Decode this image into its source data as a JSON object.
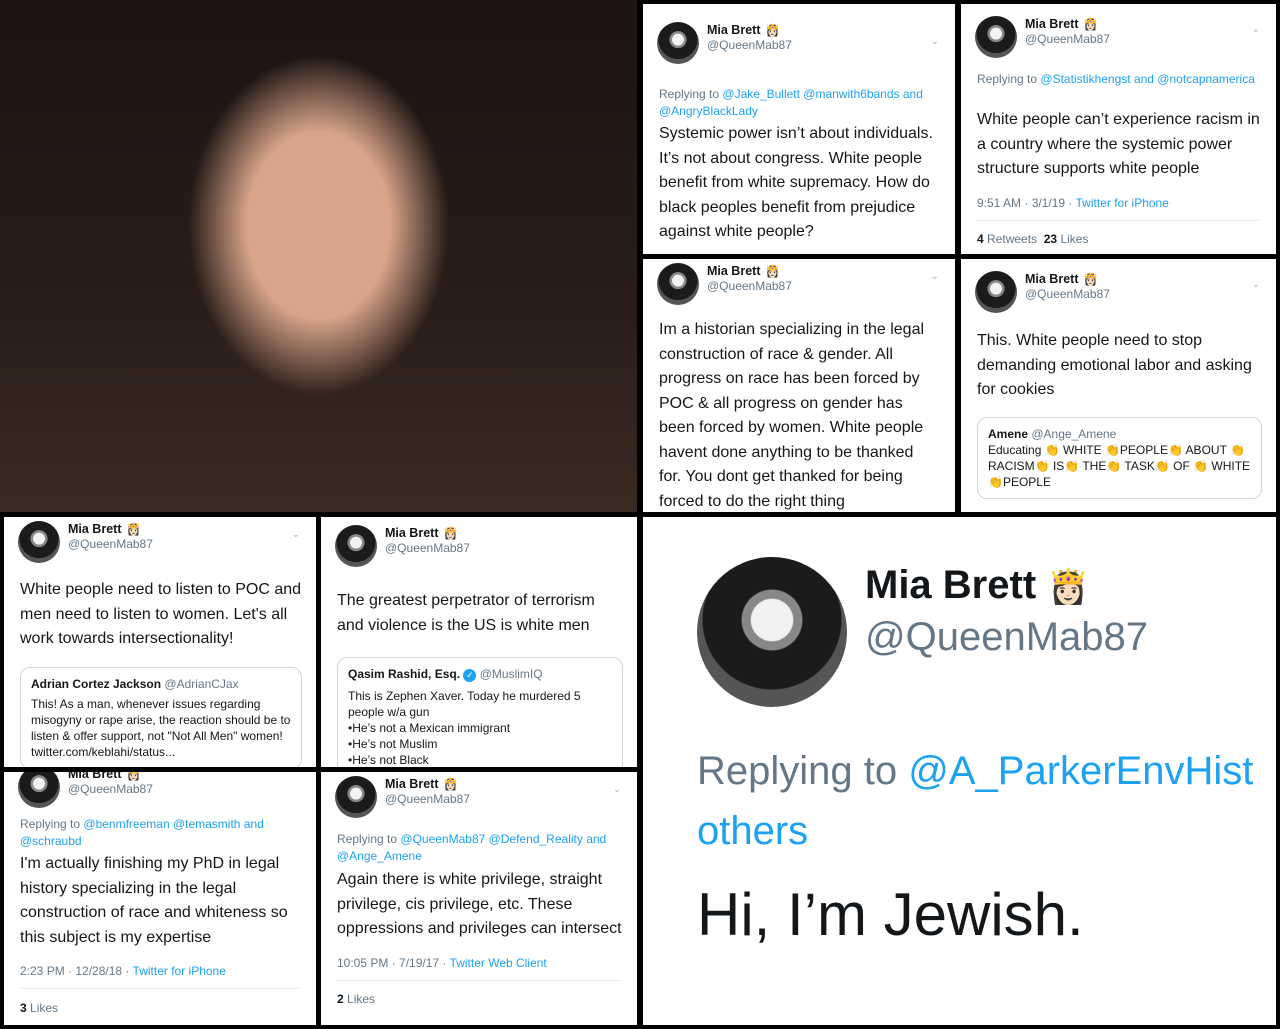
{
  "profile": {
    "name": "Mia Brett",
    "crown": "👸🏻",
    "handle": "@QueenMab87"
  },
  "tweets": [
    {
      "replying_prefix": "Replying to",
      "replying_to": "@Jake_Bullett @manwith6bands and @AngryBlackLady",
      "text": "Systemic power isn’t about individuals. It’s not about congress. White people benefit from white supremacy. How do black peoples benefit from prejudice against white people?"
    },
    {
      "replying_prefix": "Replying to",
      "replying_to": "@Statistikhengst and @notcapnamerica",
      "text": "White people can’t experience racism in a country where the systemic power structure supports white people",
      "time": "9:51 AM · 3/1/19 ·",
      "source": "Twitter for iPhone",
      "retweets_count": "4",
      "retweets_label": "Retweets",
      "likes_count": "23",
      "likes_label": "Likes"
    },
    {
      "text": "Im a historian specializing in the legal construction of race & gender. All progress on race has been forced by POC & all progress on gender has been forced by women. White people havent done anything to be thanked for. You dont get thanked for being forced to do the right thing"
    },
    {
      "text": "This. White people need to stop demanding emotional labor and asking for cookies",
      "quote": {
        "name": "Amene",
        "handle": "@Ange_Amene",
        "text": "Educating 👏 WHITE 👏PEOPLE👏 ABOUT 👏RACISM👏 IS👏 THE👏 TASK👏 OF 👏 WHITE 👏PEOPLE"
      }
    },
    {
      "text": "White people need to listen to POC and men need to listen to women. Let's all work towards intersectionality!",
      "quote": {
        "name": "Adrian Cortez Jackson",
        "handle": "@AdrianCJax",
        "text": "This! As a man, whenever issues regarding misogyny or rape arise, the reaction should be to listen & offer support, not \"Not All Men\" women! twitter.com/keblahi/status..."
      }
    },
    {
      "text": "The greatest perpetrator of terrorism and violence is the US is white men",
      "quote": {
        "name": "Qasim Rashid, Esq.",
        "verified": "✓",
        "handle": "@MuslimIQ",
        "text": "This is Zephen Xaver. Today he murdered 5 people w/a gun",
        "bullets": [
          "•He’s not a Mexican immigrant",
          "•He’s not Muslim",
          "•He’s not Black"
        ]
      }
    },
    {
      "replying_prefix": "Replying to",
      "replying_to": "@benmfreeman @temasmith and @schraubd",
      "text": "I'm actually finishing my PhD in legal history specializing in the legal construction of race and whiteness so this subject is my expertise",
      "time": "2:23 PM · 12/28/18 ·",
      "source": "Twitter for iPhone",
      "likes_count": "3",
      "likes_label": "Likes"
    },
    {
      "replying_prefix": "Replying to",
      "replying_to": "@QueenMab87 @Defend_Reality and @Ange_Amene",
      "text": "Again there is white privilege, straight privilege, cis privilege, etc. These oppressions and privileges can intersect",
      "time": "10:05 PM · 7/19/17 ·",
      "source": "Twitter Web Client",
      "likes_count": "2",
      "likes_label": "Likes"
    },
    {
      "replying_prefix": "Replying to",
      "replying_to": "@A_ParkerEnvHist",
      "replying_more": "others",
      "text": "Hi, I’m Jewish."
    }
  ]
}
